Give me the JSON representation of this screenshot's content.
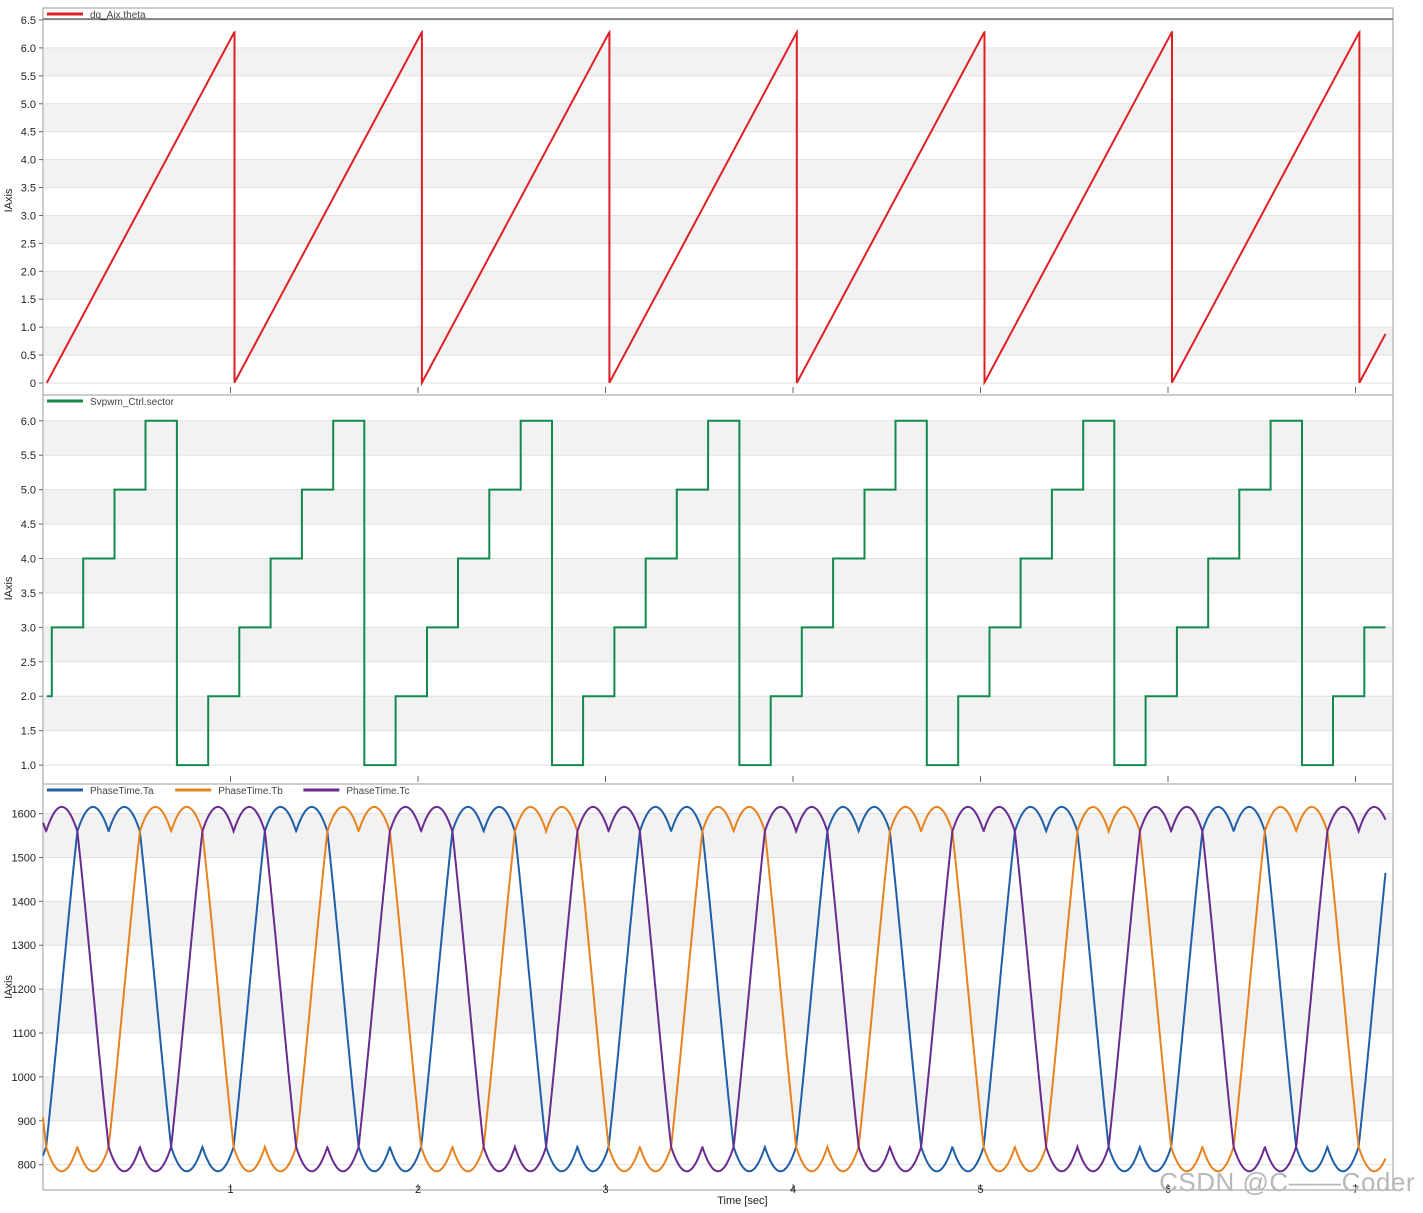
{
  "chart_data": [
    {
      "type": "line",
      "series": [
        {
          "name": "dq_Aix.theta",
          "color": "#e01f25",
          "waveform": "sawtooth",
          "period": 1.0,
          "phase_offset": 0.02,
          "y_min": 0.0,
          "y_max": 6.28
        }
      ],
      "ylabel": "IAxis",
      "xlim": [
        0,
        7.2
      ],
      "ylim": [
        0,
        6.5
      ],
      "yticks": [
        "0",
        "0.5",
        "1.0",
        "1.5",
        "2.0",
        "2.5",
        "3.0",
        "3.5",
        "4.0",
        "4.5",
        "5.0",
        "5.5",
        "6.0",
        "6.5"
      ],
      "grid": true
    },
    {
      "type": "line",
      "series": [
        {
          "name": "Svpwm_Ctrl.sector",
          "color": "#128a4c",
          "waveform": "staircase",
          "period": 1.0,
          "sequence": [
            2,
            3,
            4,
            5,
            6,
            1
          ],
          "phase_offset": 0.12
        }
      ],
      "ylabel": "IAxis",
      "xlim": [
        0,
        7.2
      ],
      "ylim": [
        0.9,
        6.2
      ],
      "yticks": [
        "1.0",
        "1.5",
        "2.0",
        "2.5",
        "3.0",
        "3.5",
        "4.0",
        "4.5",
        "5.0",
        "5.5",
        "6.0"
      ],
      "grid": true
    },
    {
      "type": "line",
      "series": [
        {
          "name": "PhaseTime.Ta",
          "color": "#1f5fa8",
          "phase_deg": 0
        },
        {
          "name": "PhaseTime.Tb",
          "color": "#e8821e",
          "phase_deg": -120
        },
        {
          "name": "PhaseTime.Tc",
          "color": "#6a2b8f",
          "phase_deg": 120
        }
      ],
      "waveform": "svpwm_phase_time",
      "period": 1.0,
      "center": 1200,
      "amplitude": 415,
      "ylabel": "IAxis",
      "xlabel": "Time [sec]",
      "xlim": [
        0,
        7.2
      ],
      "ylim": [
        765,
        1640
      ],
      "xticks": [
        "1",
        "2",
        "3",
        "4",
        "5",
        "6",
        "7"
      ],
      "yticks": [
        "800",
        "900",
        "1000",
        "1100",
        "1200",
        "1300",
        "1400",
        "1500",
        "1600"
      ],
      "grid": true
    }
  ],
  "watermark": "CSDN @C——Coder"
}
